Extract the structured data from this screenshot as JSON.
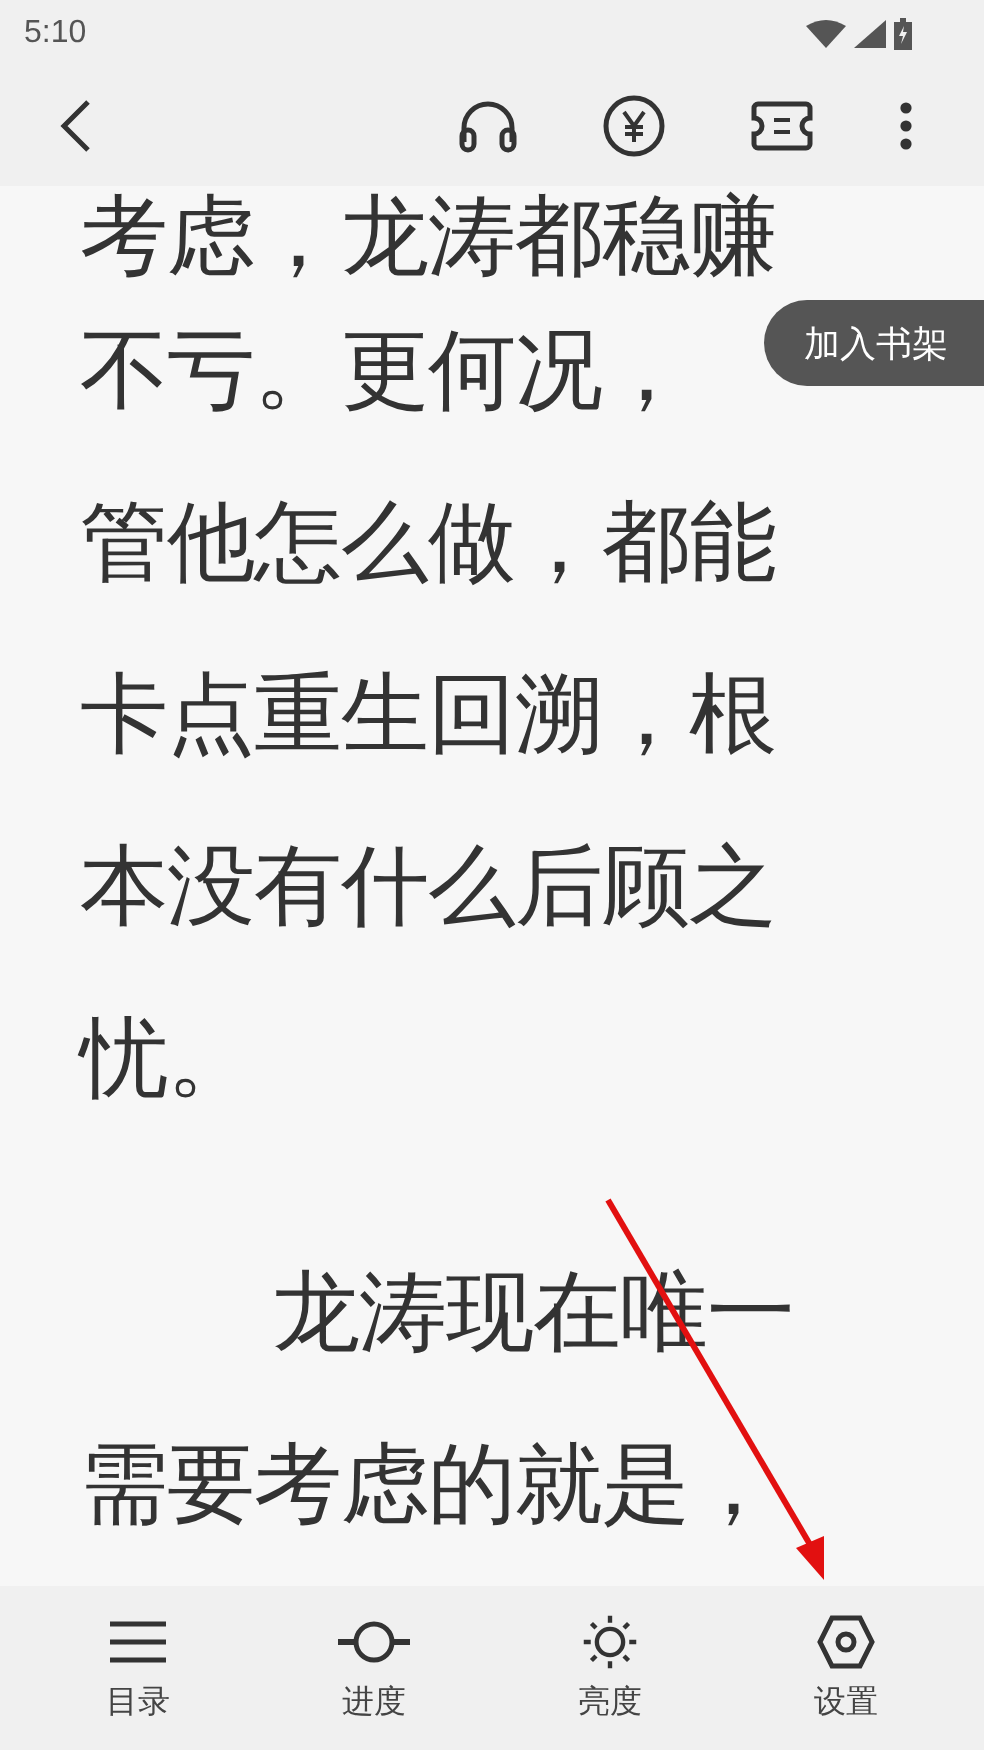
{
  "status_bar": {
    "time": "5:10"
  },
  "reader": {
    "paragraphs": [
      {
        "indent": false,
        "lines": [
          "考虑，龙涛都稳赚",
          "不亏。更何况，",
          "管他怎么做，都能",
          "卡点重生回溯，根",
          "本没有什么后顾之",
          "忧。"
        ]
      },
      {
        "indent": true,
        "lines": [
          "龙涛现在唯一",
          "需要考虑的就是，"
        ]
      }
    ]
  },
  "shelf_button": {
    "label": "加入书架"
  },
  "bottom_nav": [
    {
      "kind": "menu",
      "label": "目录"
    },
    {
      "kind": "progress",
      "label": "进度"
    },
    {
      "kind": "brightness",
      "label": "亮度"
    },
    {
      "kind": "settings",
      "label": "设置"
    }
  ]
}
